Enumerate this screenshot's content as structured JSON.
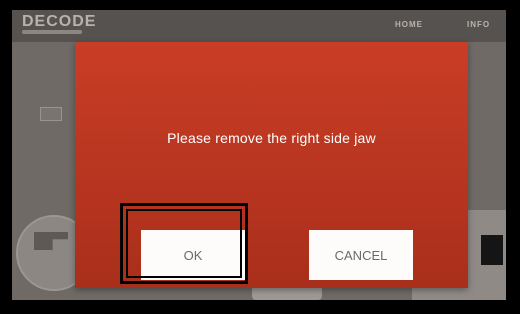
{
  "header": {
    "app_title": "DECODE",
    "nav": [
      {
        "label": "HOME"
      },
      {
        "label": "INFO"
      }
    ]
  },
  "dialog": {
    "message": "Please remove the right side jaw",
    "ok_label": "OK",
    "cancel_label": "CANCEL"
  },
  "colors": {
    "dialog_bg": "#c93d25",
    "button_bg": "#fdfcfb",
    "highlight_border": "#000000"
  }
}
